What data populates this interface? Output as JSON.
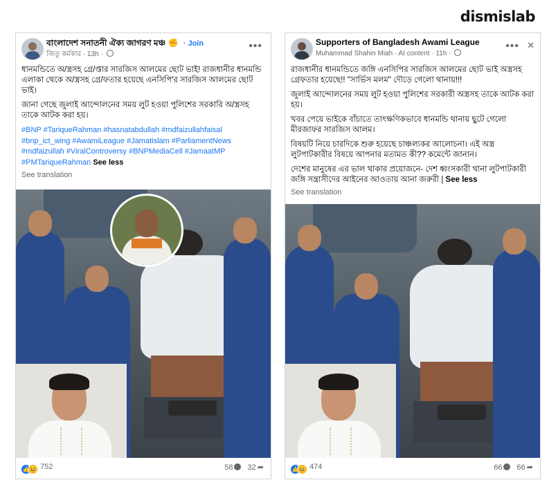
{
  "brand": "dismislab",
  "posts": [
    {
      "group_name": "বাংলাদেশ সনাতনী ঐক্য জাগরণ মঞ্চ",
      "group_emoji": "✊",
      "join_label": "· Join",
      "author": "জিতু কর্মকার",
      "time": "· 13h ·",
      "paragraphs": [
        "ধানমন্ডিতে অ/স্ত্রসহ গ্রে/প্তার সারজিস আলমের ছোট ভাই! রাজধানীর ধানমন্ডি এলাকা থেকে অ/স্ত্রসহ গ্রে/ফতার হয়েছে এনসিপি'র সারজিস আলমের ছোট ভাই।",
        "জানা গেছে জুলাই আন্দোলনের সময় লুট হওয়া পুলিশের সরকারি অ/স্ত্রসহ তাকে আটক করা হয়।"
      ],
      "hashtags": "#BNP #TariqueRahman #hasnatabdullah #mdfaizullahfaisal #bnp_ict_wing #AwamiLeague #Jamatislam #ParliamentNews #mdfaizullah #ViralControversy #BNPMediaCell #JamaatMP #PMTariqueRahman",
      "see_less": "See less",
      "see_translation": "See translation",
      "reactions_count": "752",
      "comments_count": "58",
      "shares_count": "32"
    },
    {
      "group_name": "Supporters of Bangladesh Awami League",
      "author": "Muhammad Shahin Miah",
      "time": "· AI content · 11h ·",
      "paragraphs": [
        "রাজধানীর ধানমন্ডিতে জঙ্গি এনসিপির সারজিস আলমের ছোট ভাই অস্ত্রসহ গ্রেফতার হয়েছে!! \"সার্ভিস মলম\" দৌড়ে গেলো থানায়!!!",
        "জুলাই আন্দোলনের সময় লুট হওয়া পুলিশের সরকারী অস্ত্রসহ তাকে আটক করা হয়।",
        "খবর পেয়ে ভাইকে বাঁচাতে তাৎক্ষণিকভাবে ধানমন্ডি থানায় ছুটে গেলো মীরজাফর সারজিস আলম।",
        "বিষয়টি নিয়ে চারদিকে শুরু হয়েছে চাঞ্চল্যকর আলোচনা। এই অস্ত্র লুটপাটকারীর বিষয়ে আপনার মতামত কী??    কমেন্টে জানান।",
        "দেশের মানুষের এর ভাল থাকার প্রয়োজনে- দেশ ধ্বংসকারী থানা লুটপাটকারী জঙ্গি সন্ত্রাসীদের আইনের আওতায় আনা জরুরী |"
      ],
      "see_less": "See less",
      "see_translation": "See translation",
      "reactions_count": "474",
      "comments_count": "66",
      "shares_count": "66"
    }
  ]
}
